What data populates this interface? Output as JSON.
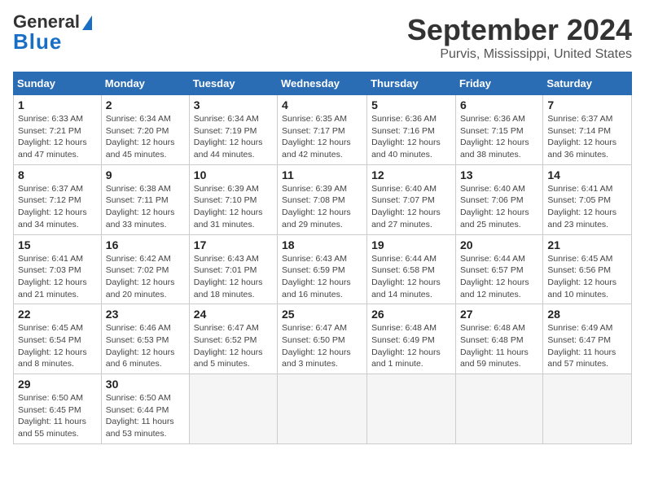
{
  "header": {
    "logo_general": "General",
    "logo_blue": "Blue",
    "title": "September 2024",
    "subtitle": "Purvis, Mississippi, United States"
  },
  "calendar": {
    "days_of_week": [
      "Sunday",
      "Monday",
      "Tuesday",
      "Wednesday",
      "Thursday",
      "Friday",
      "Saturday"
    ],
    "weeks": [
      [
        {
          "day": "1",
          "sunrise": "6:33 AM",
          "sunset": "7:21 PM",
          "daylight": "12 hours and 47 minutes."
        },
        {
          "day": "2",
          "sunrise": "6:34 AM",
          "sunset": "7:20 PM",
          "daylight": "12 hours and 45 minutes."
        },
        {
          "day": "3",
          "sunrise": "6:34 AM",
          "sunset": "7:19 PM",
          "daylight": "12 hours and 44 minutes."
        },
        {
          "day": "4",
          "sunrise": "6:35 AM",
          "sunset": "7:17 PM",
          "daylight": "12 hours and 42 minutes."
        },
        {
          "day": "5",
          "sunrise": "6:36 AM",
          "sunset": "7:16 PM",
          "daylight": "12 hours and 40 minutes."
        },
        {
          "day": "6",
          "sunrise": "6:36 AM",
          "sunset": "7:15 PM",
          "daylight": "12 hours and 38 minutes."
        },
        {
          "day": "7",
          "sunrise": "6:37 AM",
          "sunset": "7:14 PM",
          "daylight": "12 hours and 36 minutes."
        }
      ],
      [
        {
          "day": "8",
          "sunrise": "6:37 AM",
          "sunset": "7:12 PM",
          "daylight": "12 hours and 34 minutes."
        },
        {
          "day": "9",
          "sunrise": "6:38 AM",
          "sunset": "7:11 PM",
          "daylight": "12 hours and 33 minutes."
        },
        {
          "day": "10",
          "sunrise": "6:39 AM",
          "sunset": "7:10 PM",
          "daylight": "12 hours and 31 minutes."
        },
        {
          "day": "11",
          "sunrise": "6:39 AM",
          "sunset": "7:08 PM",
          "daylight": "12 hours and 29 minutes."
        },
        {
          "day": "12",
          "sunrise": "6:40 AM",
          "sunset": "7:07 PM",
          "daylight": "12 hours and 27 minutes."
        },
        {
          "day": "13",
          "sunrise": "6:40 AM",
          "sunset": "7:06 PM",
          "daylight": "12 hours and 25 minutes."
        },
        {
          "day": "14",
          "sunrise": "6:41 AM",
          "sunset": "7:05 PM",
          "daylight": "12 hours and 23 minutes."
        }
      ],
      [
        {
          "day": "15",
          "sunrise": "6:41 AM",
          "sunset": "7:03 PM",
          "daylight": "12 hours and 21 minutes."
        },
        {
          "day": "16",
          "sunrise": "6:42 AM",
          "sunset": "7:02 PM",
          "daylight": "12 hours and 20 minutes."
        },
        {
          "day": "17",
          "sunrise": "6:43 AM",
          "sunset": "7:01 PM",
          "daylight": "12 hours and 18 minutes."
        },
        {
          "day": "18",
          "sunrise": "6:43 AM",
          "sunset": "6:59 PM",
          "daylight": "12 hours and 16 minutes."
        },
        {
          "day": "19",
          "sunrise": "6:44 AM",
          "sunset": "6:58 PM",
          "daylight": "12 hours and 14 minutes."
        },
        {
          "day": "20",
          "sunrise": "6:44 AM",
          "sunset": "6:57 PM",
          "daylight": "12 hours and 12 minutes."
        },
        {
          "day": "21",
          "sunrise": "6:45 AM",
          "sunset": "6:56 PM",
          "daylight": "12 hours and 10 minutes."
        }
      ],
      [
        {
          "day": "22",
          "sunrise": "6:45 AM",
          "sunset": "6:54 PM",
          "daylight": "12 hours and 8 minutes."
        },
        {
          "day": "23",
          "sunrise": "6:46 AM",
          "sunset": "6:53 PM",
          "daylight": "12 hours and 6 minutes."
        },
        {
          "day": "24",
          "sunrise": "6:47 AM",
          "sunset": "6:52 PM",
          "daylight": "12 hours and 5 minutes."
        },
        {
          "day": "25",
          "sunrise": "6:47 AM",
          "sunset": "6:50 PM",
          "daylight": "12 hours and 3 minutes."
        },
        {
          "day": "26",
          "sunrise": "6:48 AM",
          "sunset": "6:49 PM",
          "daylight": "12 hours and 1 minute."
        },
        {
          "day": "27",
          "sunrise": "6:48 AM",
          "sunset": "6:48 PM",
          "daylight": "11 hours and 59 minutes."
        },
        {
          "day": "28",
          "sunrise": "6:49 AM",
          "sunset": "6:47 PM",
          "daylight": "11 hours and 57 minutes."
        }
      ],
      [
        {
          "day": "29",
          "sunrise": "6:50 AM",
          "sunset": "6:45 PM",
          "daylight": "11 hours and 55 minutes."
        },
        {
          "day": "30",
          "sunrise": "6:50 AM",
          "sunset": "6:44 PM",
          "daylight": "11 hours and 53 minutes."
        },
        null,
        null,
        null,
        null,
        null
      ]
    ]
  }
}
